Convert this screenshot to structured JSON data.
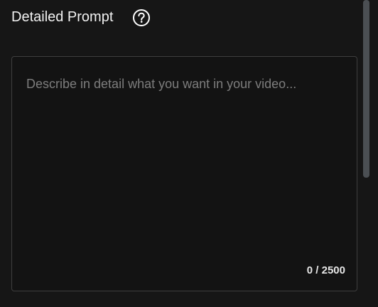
{
  "header": {
    "title": "Detailed Prompt",
    "help_icon": "question-circle-icon"
  },
  "prompt": {
    "value": "",
    "placeholder": "Describe in detail what you want in your video...",
    "counter": "0 / 2500"
  },
  "colors": {
    "background": "#161616",
    "border": "#3f3f3f",
    "text": "#ffffff",
    "placeholder": "#7d7d7d",
    "scrollbar": "#4b4f53"
  }
}
